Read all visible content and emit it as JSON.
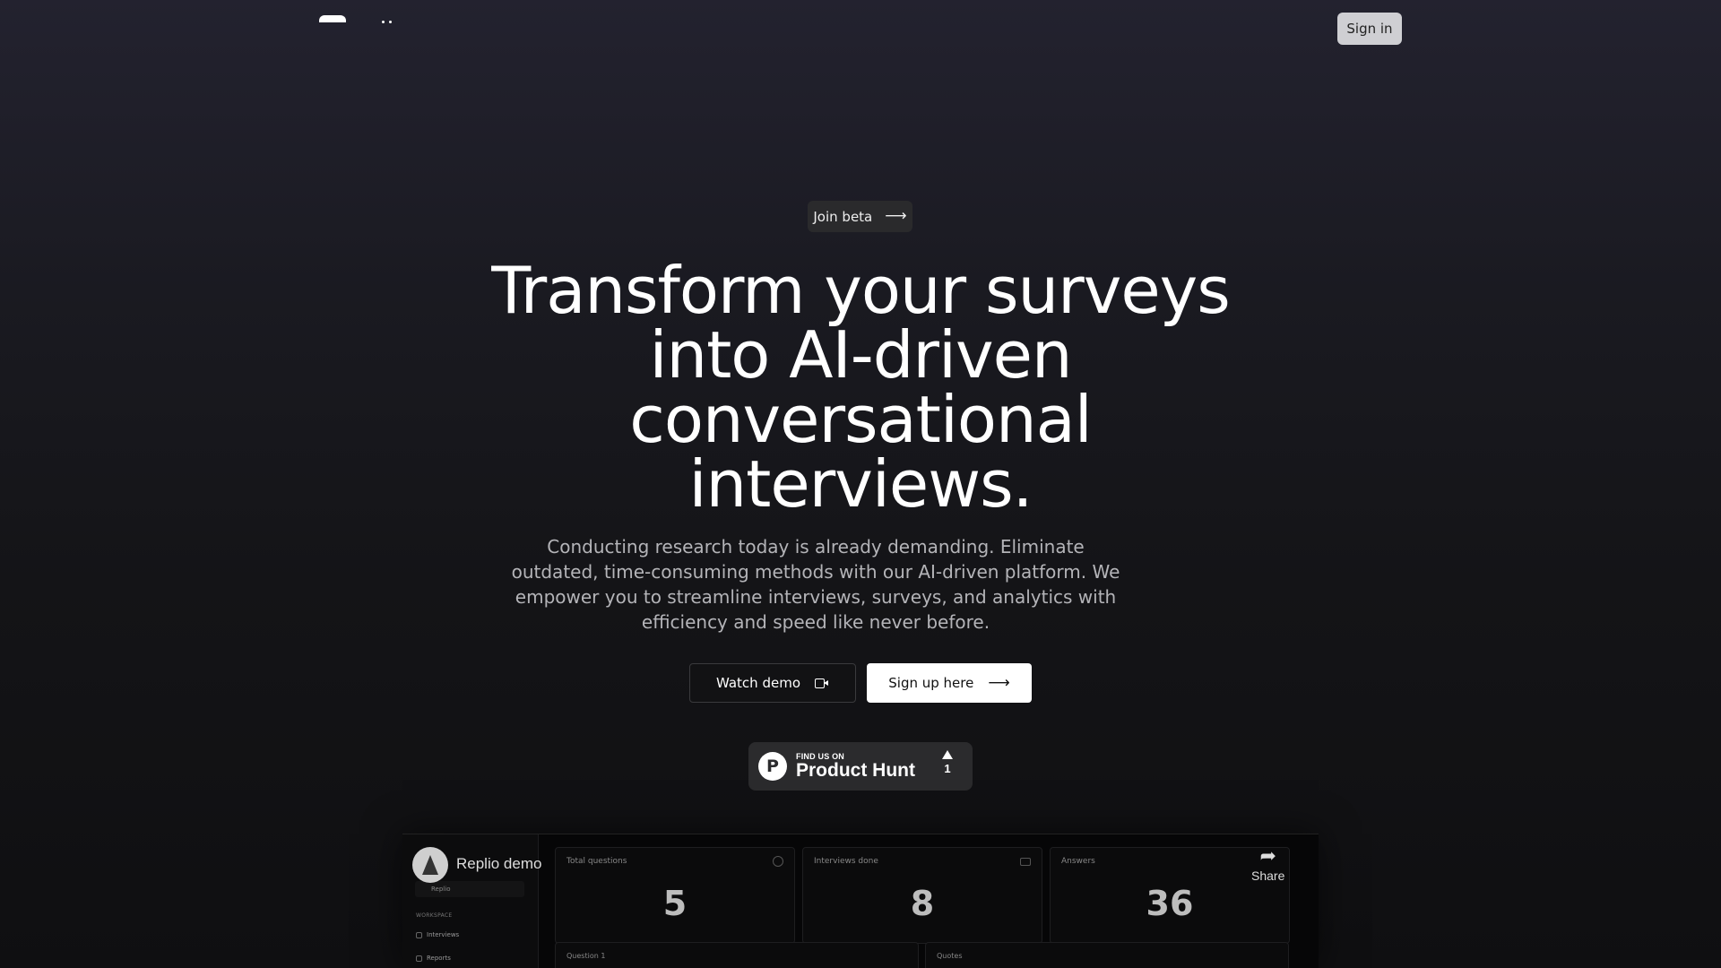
{
  "nav": {
    "sign_in_label": "Sign in"
  },
  "hero": {
    "badge_label": "Join beta",
    "headline": "Transform your surveys into AI-driven conversational interviews.",
    "subtext": "Conducting research today is already demanding. Eliminate outdated, time-consuming methods with our AI-driven platform. We empower you to streamline interviews, surveys, and analytics with efficiency and speed like never before.",
    "watch_demo_label": "Watch demo",
    "sign_up_label": "Sign up here",
    "arrow_glyph": "⟶"
  },
  "product_hunt": {
    "small_text": "FIND US ON",
    "big_text": "Product Hunt",
    "logo_letter": "P",
    "upvotes": "1"
  },
  "video": {
    "title": "Replio demo",
    "share_label": "Share",
    "sidebar": {
      "workspace_select": "Replio",
      "section_label": "WORKSPACE",
      "items": [
        "Interviews",
        "Reports"
      ]
    },
    "stats": [
      {
        "title": "Total questions",
        "value": "5"
      },
      {
        "title": "Interviews done",
        "value": "8"
      },
      {
        "title": "Answers",
        "value": "36"
      }
    ],
    "panels": [
      "Question 1",
      "Quotes"
    ]
  },
  "colors": {
    "background_top": "#23222f",
    "background_bottom": "#0f0f11",
    "sign_in_bg": "#cfcfd3",
    "badge_bg": "#2a2a2c",
    "subtext": "#b4b4b8",
    "primary_button_bg": "#ffffff"
  },
  "icons": {
    "watch_demo": "video-camera-icon",
    "sign_up": "arrow-right-icon",
    "badge": "arrow-right-icon",
    "product_hunt_vote": "triangle-up-icon",
    "share": "share-arrow-icon"
  }
}
